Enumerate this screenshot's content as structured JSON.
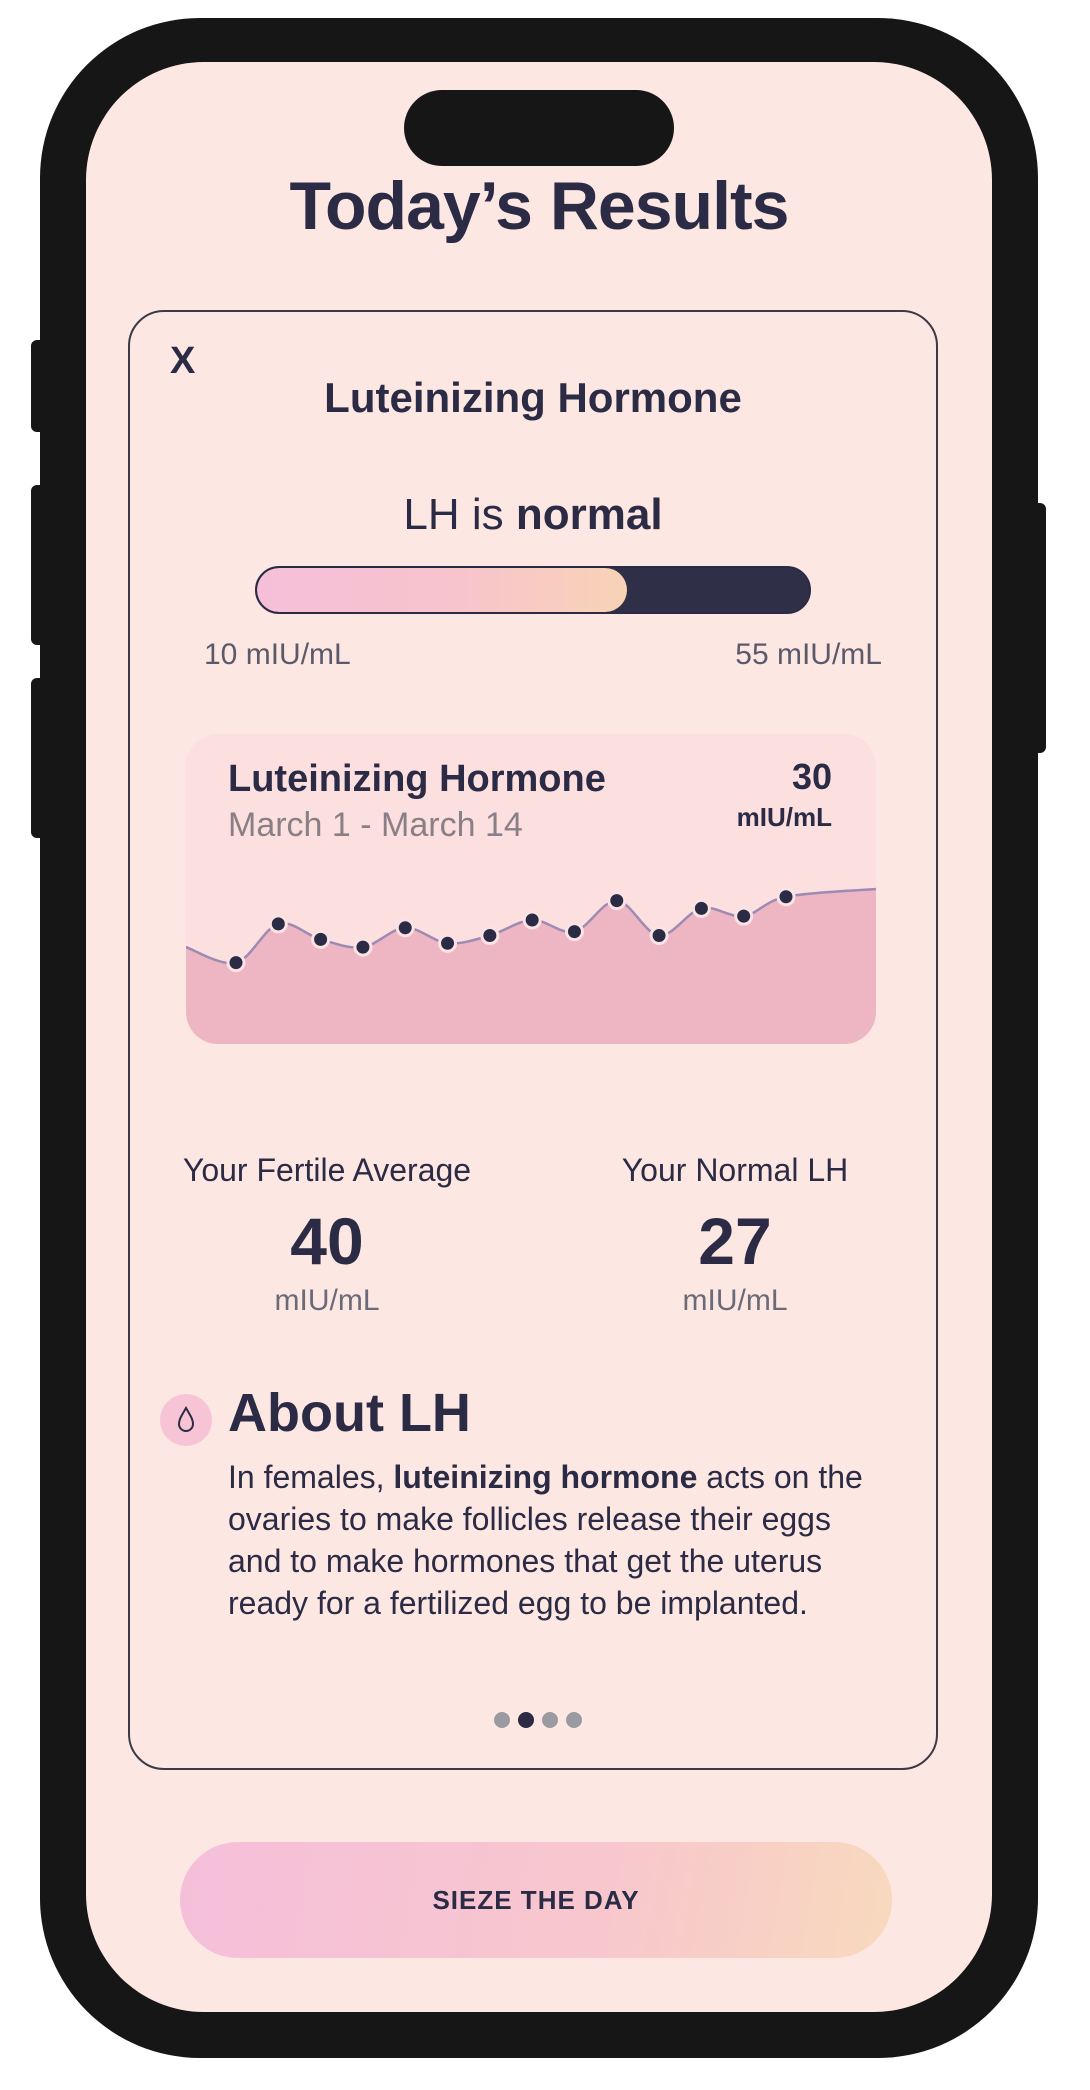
{
  "page": {
    "title": "Today’s Results"
  },
  "card": {
    "close_label": "X",
    "title": "Luteinizing Hormone",
    "status_prefix": "LH is ",
    "status_value": "normal",
    "range": {
      "min_label": "10 mIU/mL",
      "max_label": "55 mIU/mL",
      "fill_fraction": 0.67
    }
  },
  "chart": {
    "title": "Luteinizing Hormone",
    "dates": "March 1 - March 14",
    "value": "30",
    "unit": "mIU/mL"
  },
  "chart_data": {
    "type": "area",
    "title": "Luteinizing Hormone",
    "subtitle": "March 1 - March 14",
    "values": [
      21,
      31,
      27,
      25,
      30,
      26,
      28,
      32,
      29,
      37,
      28,
      35,
      33,
      38
    ],
    "ylim": [
      0,
      80
    ],
    "grid": false,
    "colors": {
      "fill": "#eeb6c2",
      "line": "#9d8bb3",
      "point": "#2b2b45"
    }
  },
  "stats": [
    {
      "label": "Your Fertile Average",
      "value": "40",
      "unit": "mIU/mL"
    },
    {
      "label": "Your Normal LH",
      "value": "27",
      "unit": "mIU/mL"
    }
  ],
  "about": {
    "icon": "drop-icon",
    "title": "About LH",
    "text_prefix": "In females, ",
    "text_bold": "luteinizing hormone",
    "text_rest": " acts on the ovaries to make follicles release their eggs and to make hormones that get the uterus ready for a fertilized egg to be implanted."
  },
  "pager": {
    "count": 4,
    "active": 1
  },
  "cta": {
    "label": "SIEZE THE DAY"
  },
  "colors": {
    "background": "#fde7e2",
    "ink": "#2b2b45",
    "accent_pink": "#f6bfd9",
    "accent_peach": "#f8d3b6"
  }
}
